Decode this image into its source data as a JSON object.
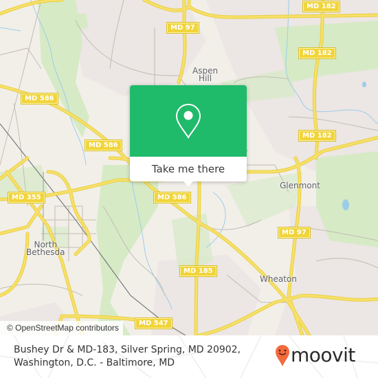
{
  "map": {
    "attribution": "© OpenStreetMap contributors",
    "colors": {
      "land": "#f2efe9",
      "park": "#d4eac2",
      "road_major": "#f5dc55",
      "road_minor": "#bdb8b0",
      "water": "#9ccde8",
      "rail": "#777777",
      "residential": "#ece6e4"
    },
    "route_shields": [
      {
        "id": "md182-top",
        "label": "MD 182"
      },
      {
        "id": "md97-top",
        "label": "MD 97"
      },
      {
        "id": "md182-upper",
        "label": "MD 182"
      },
      {
        "id": "md586-left",
        "label": "MD 586"
      },
      {
        "id": "md586-mid",
        "label": "MD 586"
      },
      {
        "id": "md182-lower",
        "label": "MD 182"
      },
      {
        "id": "md355",
        "label": "MD 355"
      },
      {
        "id": "md586-center",
        "label": "MD 586"
      },
      {
        "id": "md97-right",
        "label": "MD 97"
      },
      {
        "id": "md185",
        "label": "MD 185"
      },
      {
        "id": "md547",
        "label": "MD 547"
      }
    ],
    "places": [
      {
        "id": "aspen-hill",
        "label": "Aspen\nHill"
      },
      {
        "id": "glenmont",
        "label": "Glenmont"
      },
      {
        "id": "north-bethesda",
        "label": "North\nBethesda"
      },
      {
        "id": "wheaton",
        "label": "Wheaton"
      }
    ]
  },
  "popup": {
    "icon": "map-pin-icon",
    "button_label": "Take me there",
    "color": "#1fba6a"
  },
  "footer": {
    "address_line1": "Bushey Dr & MD-183, Silver Spring, MD 20902,",
    "address_line2": "Washington, D.C. - Baltimore, MD",
    "brand": {
      "name": "moovit",
      "icon": "moovit-pin-icon",
      "accent": "#f26a3d"
    }
  }
}
